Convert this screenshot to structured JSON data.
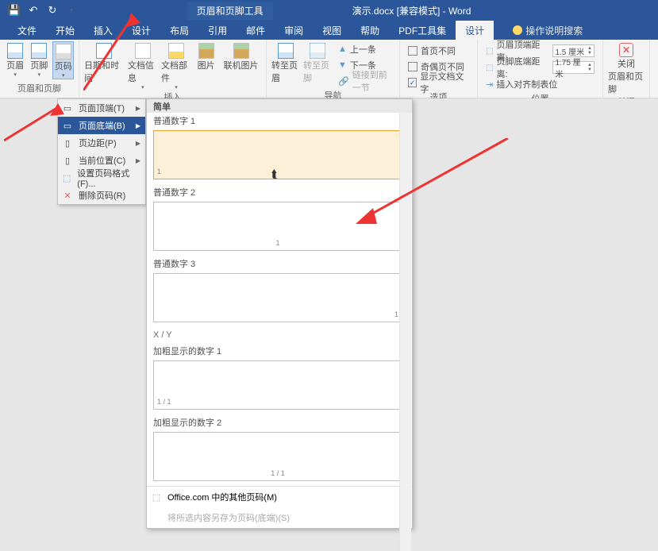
{
  "app": {
    "ctx_tab": "页眉和页脚工具",
    "doc_title": "演示.docx [兼容模式] - Word"
  },
  "tabs": {
    "file": "文件",
    "home": "开始",
    "insert": "插入",
    "design_main": "设计",
    "layout": "布局",
    "references": "引用",
    "mailings": "邮件",
    "review": "审阅",
    "view": "视图",
    "help_label": "帮助",
    "pdf": "PDF工具集",
    "design": "设计",
    "tell_me": "操作说明搜索"
  },
  "ribbon": {
    "header": "页眉",
    "footer": "页脚",
    "page_num": "页码",
    "datetime": "日期和时间",
    "docinfo": "文档信息",
    "quickparts": "文档部件",
    "picture": "图片",
    "online_pic": "联机图片",
    "goto_header": "转至页眉",
    "goto_footer": "转至页脚",
    "prev": "上一条",
    "next": "下一条",
    "link_prev": "链接到前一节",
    "diff_first": "首页不同",
    "diff_odd_even": "奇偶页不同",
    "show_doc_text": "显示文档文字",
    "header_dist_label": "页眉顶端距离:",
    "footer_dist_label": "页脚底端距离:",
    "header_dist": "1.5 厘米",
    "footer_dist": "1.75 厘米",
    "align_tab": "插入对齐制表位",
    "close": "关闭",
    "close_hf": "页眉和页脚",
    "g_hf": "页眉和页脚",
    "g_insert": "插入",
    "g_nav": "导航",
    "g_options": "选项",
    "g_position": "位置",
    "g_close": "关闭"
  },
  "menu": {
    "top": "页面顶端(T)",
    "bottom": "页面底端(B)",
    "margin": "页边距(P)",
    "current": "当前位置(C)",
    "format": "设置页码格式(F)...",
    "remove": "删除页码(R)"
  },
  "gallery": {
    "header": "简单",
    "item1": "普通数字 1",
    "item2": "普通数字 2",
    "item3": "普通数字 3",
    "cat_xy": "X / Y",
    "item4": "加粗显示的数字 1",
    "item5": "加粗显示的数字 2",
    "office_more": "Office.com 中的其他页码(M)",
    "save_selection": "将所选内容另存为页码(底端)(S)",
    "sample_left": "1",
    "sample_center": "1",
    "sample_right": "1",
    "sample_xy1": "1 / 1",
    "sample_xy2": "1 / 1"
  }
}
